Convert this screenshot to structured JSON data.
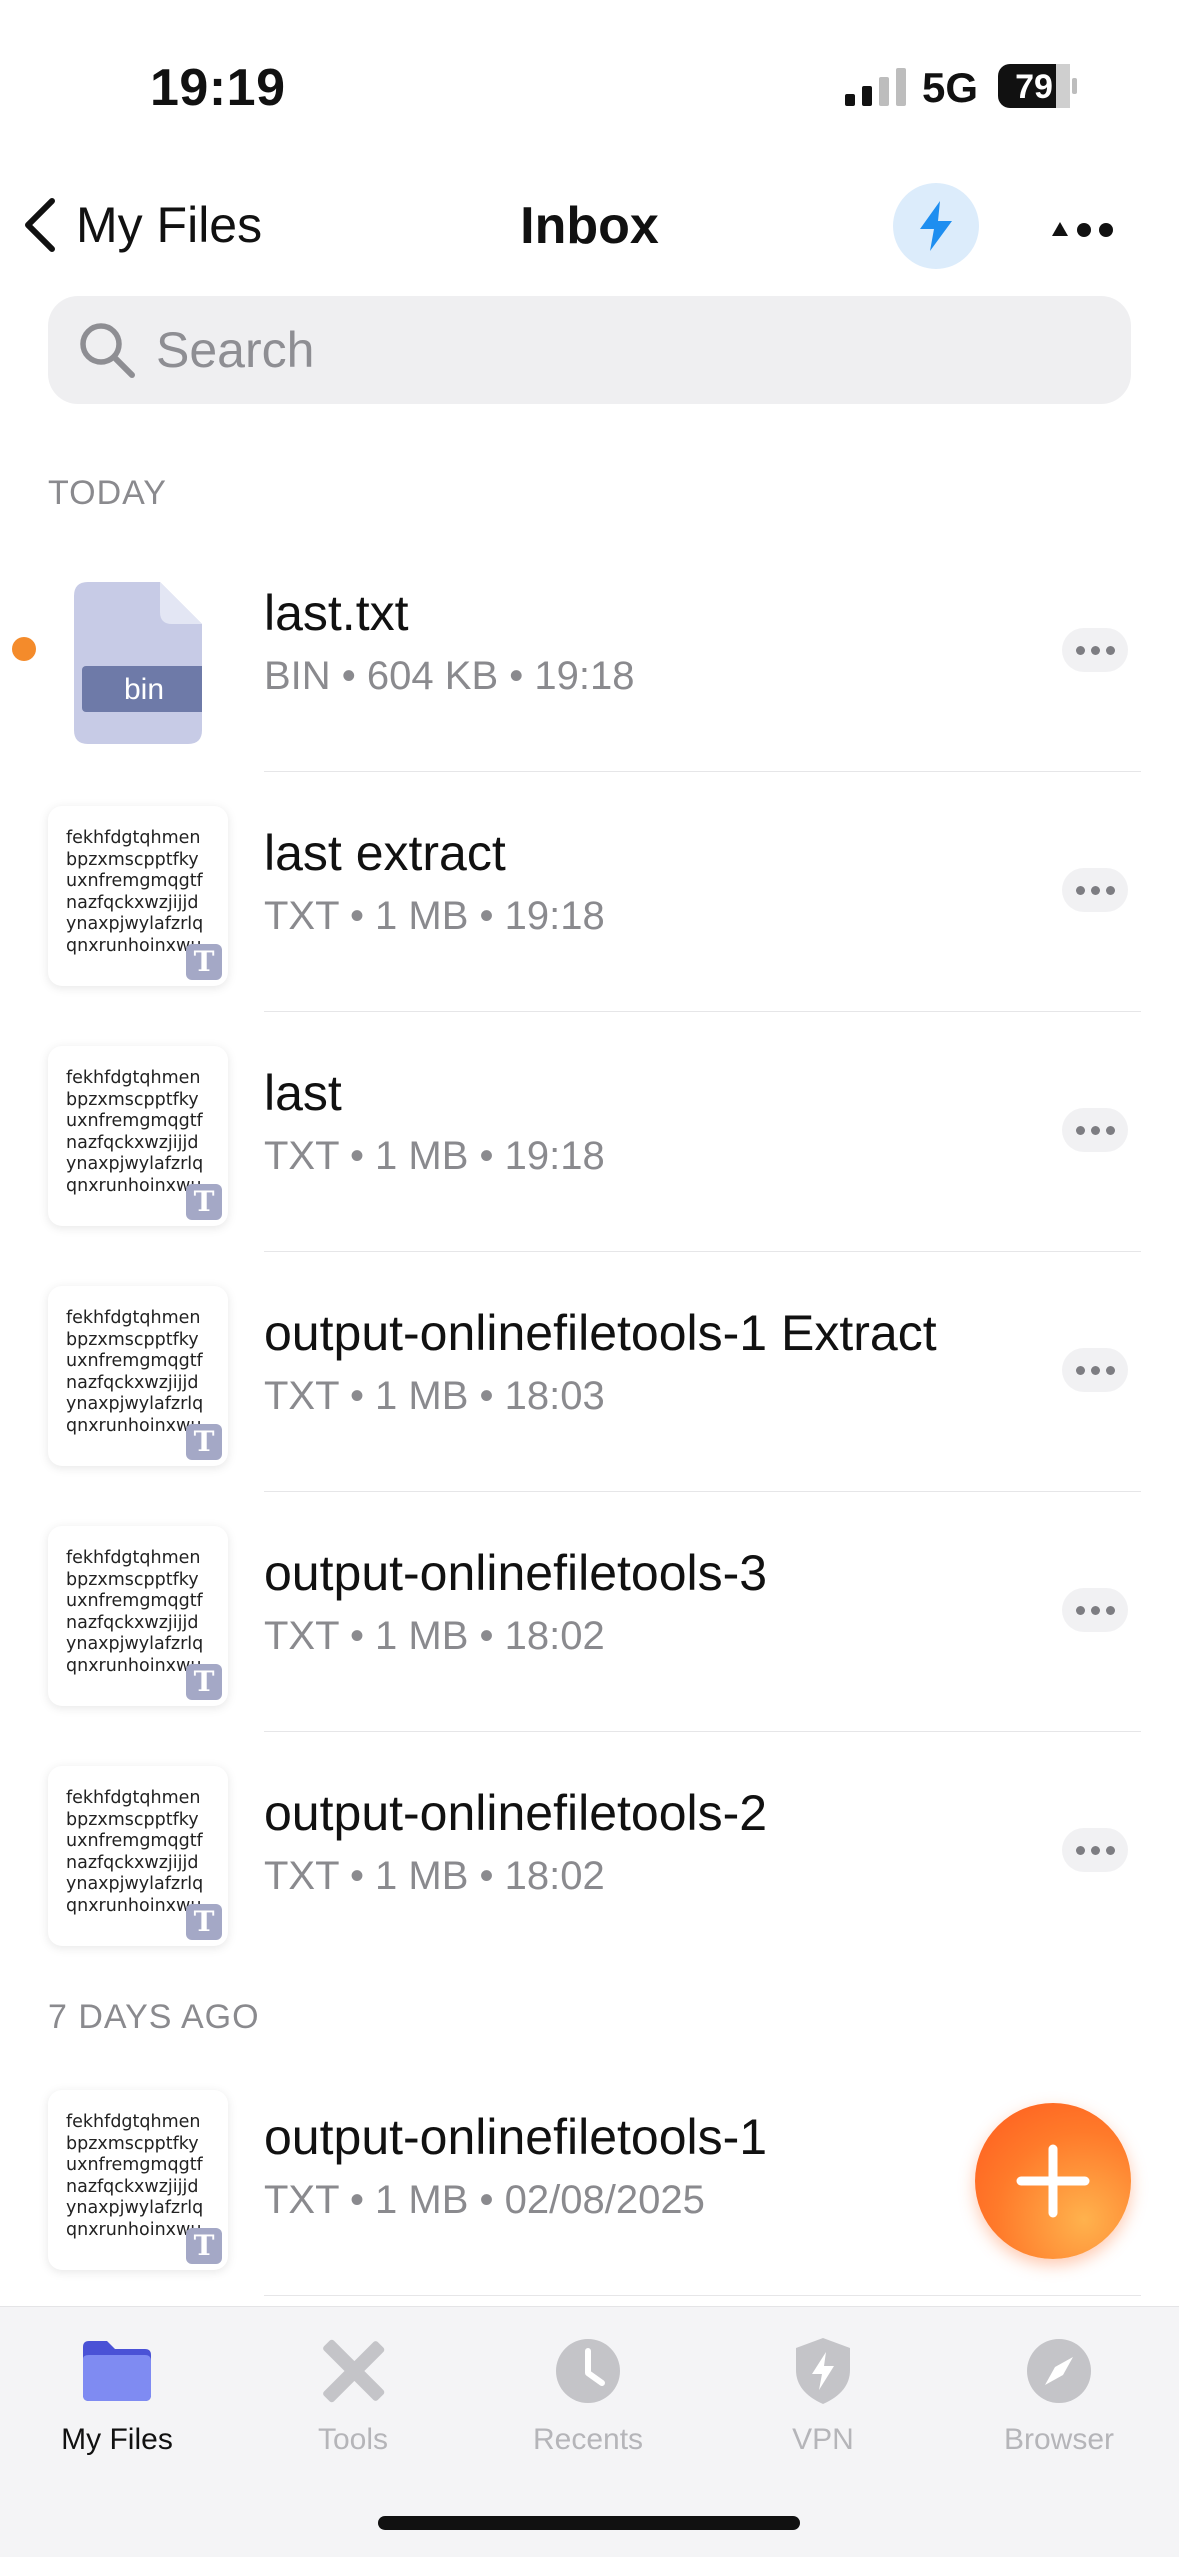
{
  "status_bar": {
    "time": "19:19",
    "network": "5G",
    "battery": "79"
  },
  "nav": {
    "back_label": "My Files",
    "title": "Inbox"
  },
  "search": {
    "placeholder": "Search"
  },
  "sections": [
    {
      "header": "TODAY"
    },
    {
      "header": "7 DAYS AGO"
    }
  ],
  "thumb_text": "fekhfdgtqhmen\nbpzxmscpptfky\nuxnfremgmqgtf\nnazfqckxwzjijjd\nynaxpjwylafzrlq\nqnxrunhoinxwu",
  "bin_label": "bin",
  "txt_badge": "T",
  "files": [
    {
      "name": "last.txt",
      "meta": "BIN • 604 KB • 19:18",
      "kind": "bin",
      "unread": true
    },
    {
      "name": "last extract",
      "meta": "TXT • 1 MB • 19:18",
      "kind": "txt"
    },
    {
      "name": "last",
      "meta": "TXT • 1 MB • 19:18",
      "kind": "txt"
    },
    {
      "name": "output-onlinefiletools-1 Extract",
      "meta": "TXT • 1 MB • 18:03",
      "kind": "txt"
    },
    {
      "name": "output-onlinefiletools-3",
      "meta": "TXT • 1 MB • 18:02",
      "kind": "txt"
    },
    {
      "name": "output-onlinefiletools-2",
      "meta": "TXT • 1 MB • 18:02",
      "kind": "txt"
    },
    {
      "name": "output-onlinefiletools-1",
      "meta": "TXT • 1 MB • 02/08/2025",
      "kind": "txt"
    }
  ],
  "tabs": [
    {
      "label": "My Files",
      "icon": "folder-icon",
      "active": true
    },
    {
      "label": "Tools",
      "icon": "tools-icon"
    },
    {
      "label": "Recents",
      "icon": "clock-icon"
    },
    {
      "label": "VPN",
      "icon": "shield-icon"
    },
    {
      "label": "Browser",
      "icon": "compass-icon"
    }
  ],
  "colors": {
    "accent_orange": "#ff7a2a",
    "unread_dot": "#f48b2b",
    "bolt_blue": "#1e8ef0",
    "folder_blue": "#5b63e6"
  }
}
